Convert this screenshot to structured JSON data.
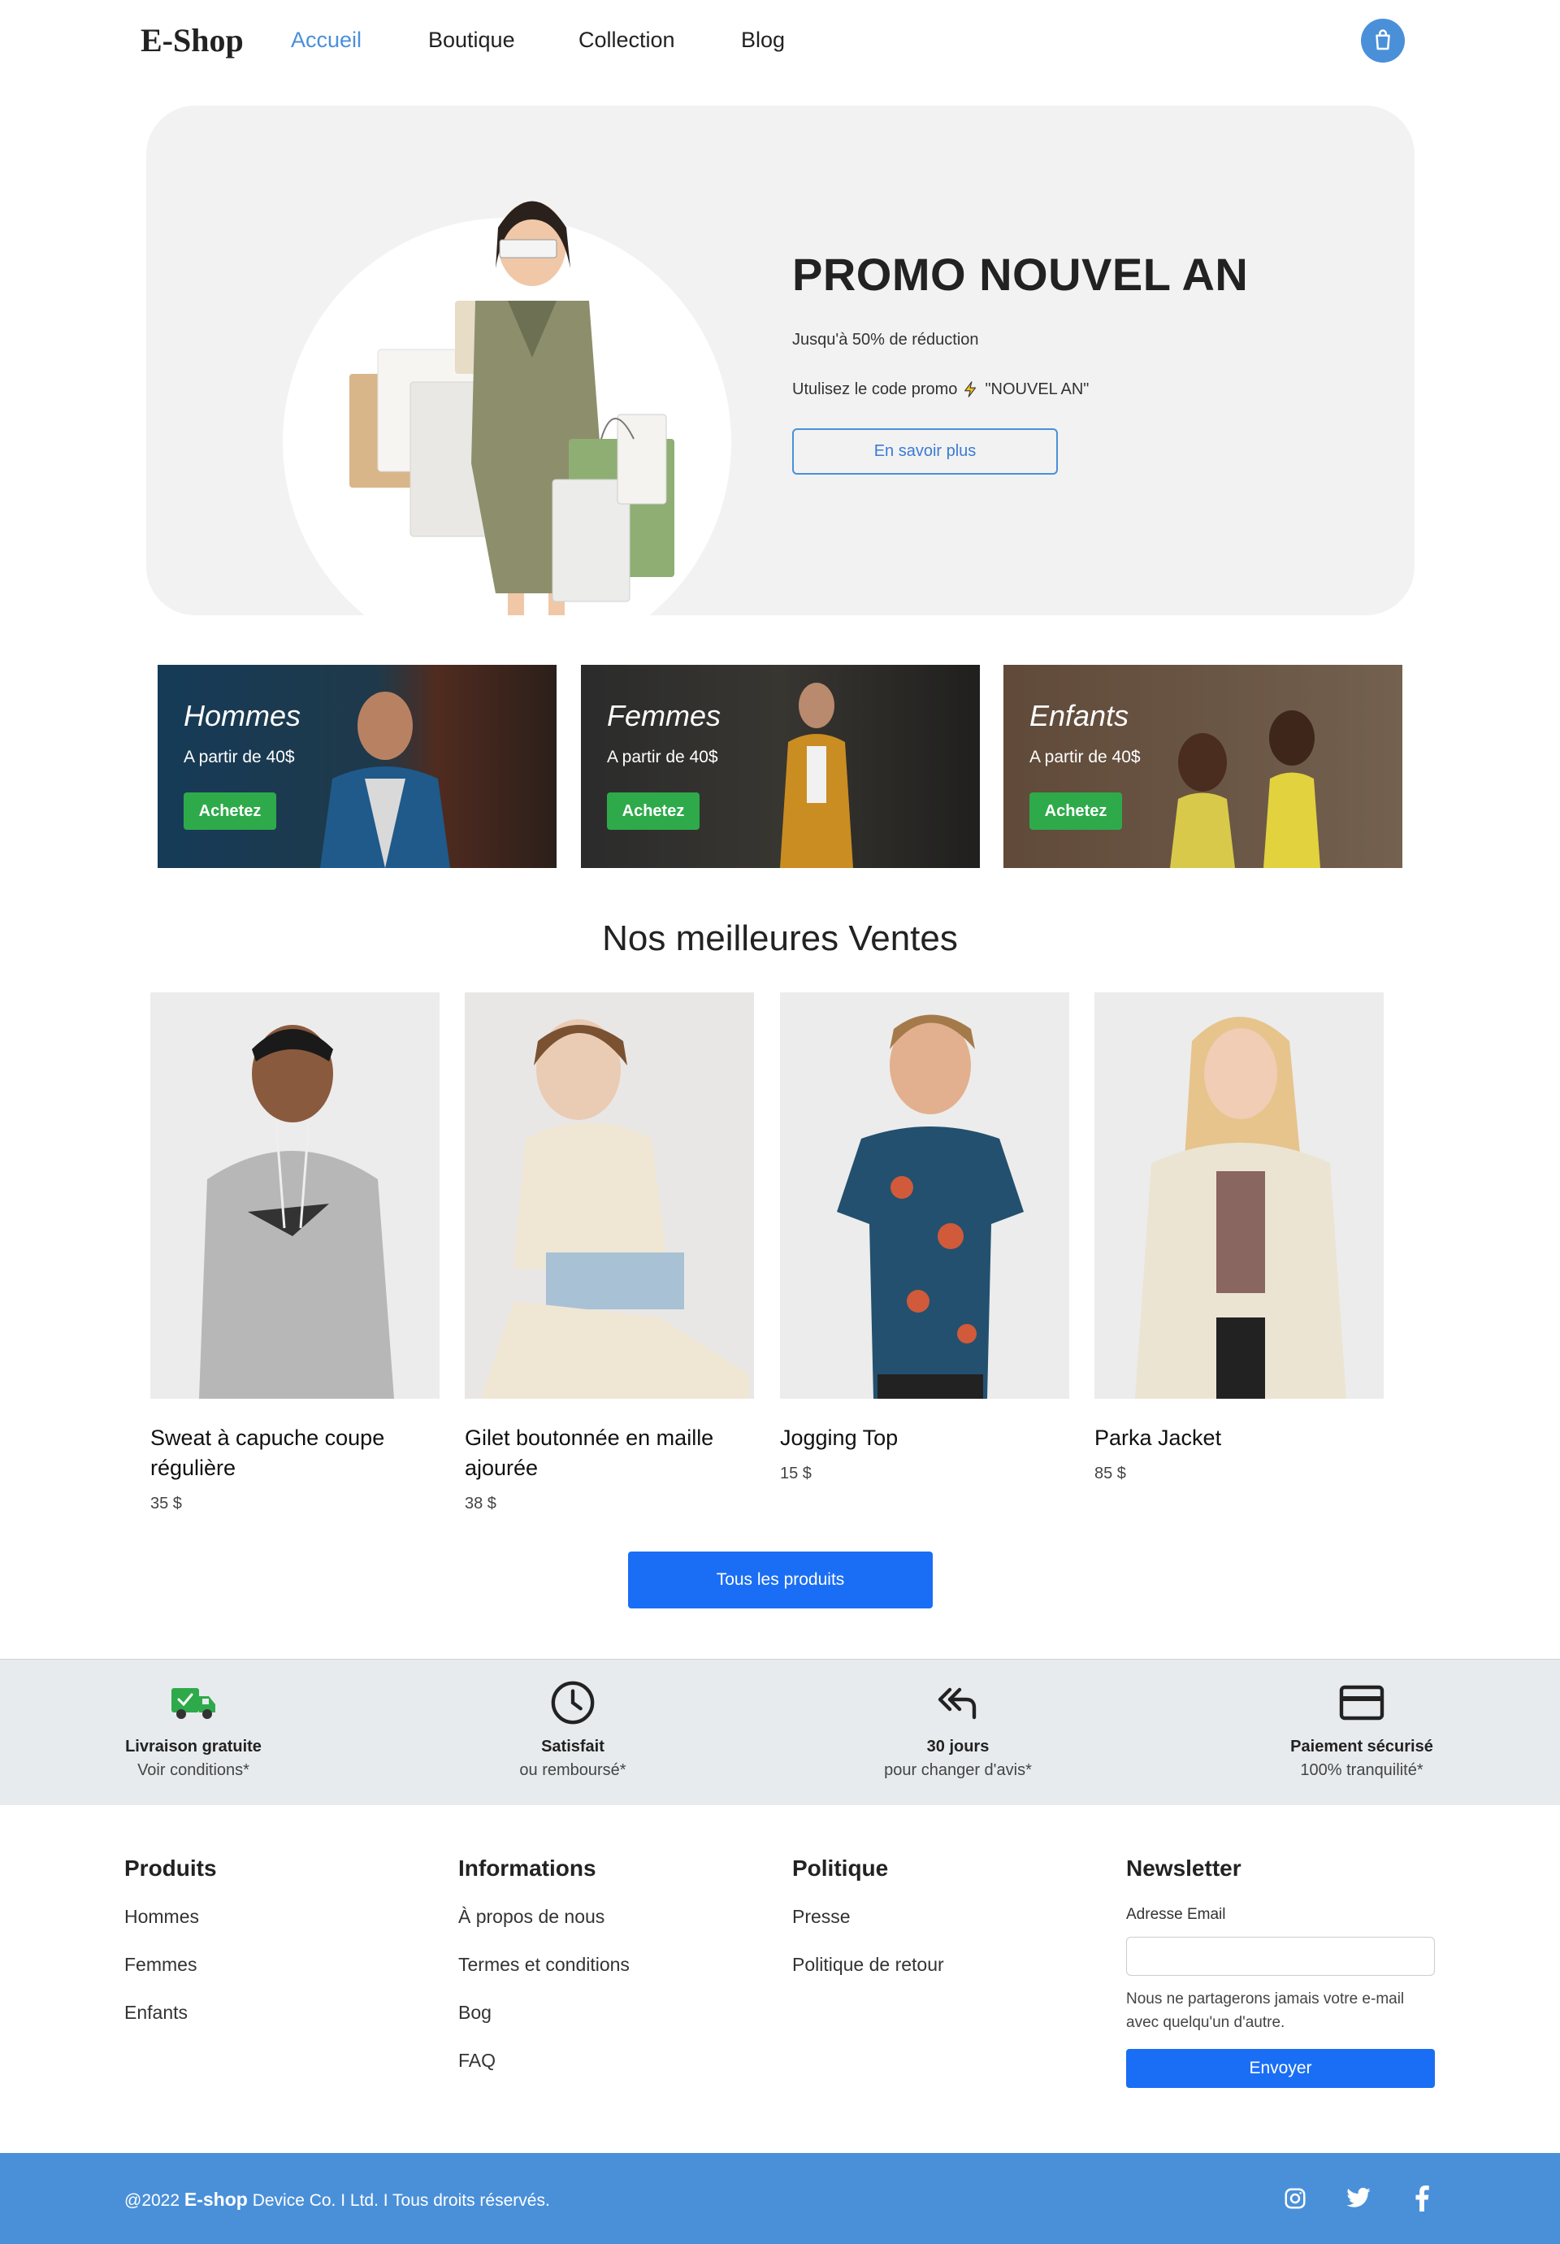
{
  "brand": {
    "name": "E-Shop",
    "accent": "#4a90d9",
    "button_blue": "#1a6ef5",
    "green": "#2eaa4a"
  },
  "nav": {
    "links": [
      {
        "label": "Accueil",
        "active": true
      },
      {
        "label": "Boutique",
        "active": false
      },
      {
        "label": "Collection",
        "active": false
      },
      {
        "label": "Blog",
        "active": false
      }
    ],
    "cart_icon": "shopping-bag-icon"
  },
  "hero": {
    "title": "PROMO NOUVEL AN",
    "line1": "Jusqu'à 50% de réduction",
    "line2_prefix": "Utulisez le code promo",
    "line2_icon": "lightning-icon",
    "line2_code": "\"NOUVEL AN\"",
    "button": "En savoir plus"
  },
  "categories": [
    {
      "title": "Hommes",
      "subtitle": "A partir de 40$",
      "button": "Achetez"
    },
    {
      "title": "Femmes",
      "subtitle": "A partir de 40$",
      "button": "Achetez"
    },
    {
      "title": "Enfants",
      "subtitle": "A partir de 40$",
      "button": "Achetez"
    }
  ],
  "best_sellers": {
    "title": "Nos meilleures Ventes",
    "products": [
      {
        "name": "Sweat à capuche coupe régulière",
        "price": "35 $"
      },
      {
        "name": "Gilet boutonnée en maille ajourée",
        "price": "38 $"
      },
      {
        "name": "Jogging Top",
        "price": "15 $"
      },
      {
        "name": "Parka Jacket",
        "price": "85 $"
      }
    ],
    "all_button": "Tous les produits"
  },
  "features": [
    {
      "icon": "delivery-truck-icon",
      "title": "Livraison gratuite",
      "subtitle": "Voir conditions*"
    },
    {
      "icon": "clock-icon",
      "title": "Satisfait",
      "subtitle": "ou remboursé*"
    },
    {
      "icon": "return-arrow-icon",
      "title": "30 jours",
      "subtitle": "pour changer d'avis*"
    },
    {
      "icon": "credit-card-icon",
      "title": "Paiement sécurisé",
      "subtitle": "100% tranquilité*"
    }
  ],
  "footer": {
    "products": {
      "title": "Produits",
      "links": [
        "Hommes",
        "Femmes",
        "Enfants"
      ]
    },
    "informations": {
      "title": "Informations",
      "links": [
        "À propos de nous",
        "Termes et conditions",
        "Bog",
        "FAQ"
      ]
    },
    "politique": {
      "title": "Politique",
      "links": [
        "Presse",
        "Politique de retour"
      ]
    },
    "newsletter": {
      "title": "Newsletter",
      "email_label": "Adresse Email",
      "email_value": "",
      "note": "Nous ne partagerons jamais votre e-mail avec quelqu'un d'autre.",
      "button": "Envoyer"
    }
  },
  "bottom": {
    "copyright_prefix": "@2022",
    "copyright_brand": "E-shop",
    "copyright_suffix": "Device Co. I Ltd. I Tous droits réservés.",
    "social": [
      "instagram-icon",
      "twitter-icon",
      "facebook-icon"
    ]
  }
}
